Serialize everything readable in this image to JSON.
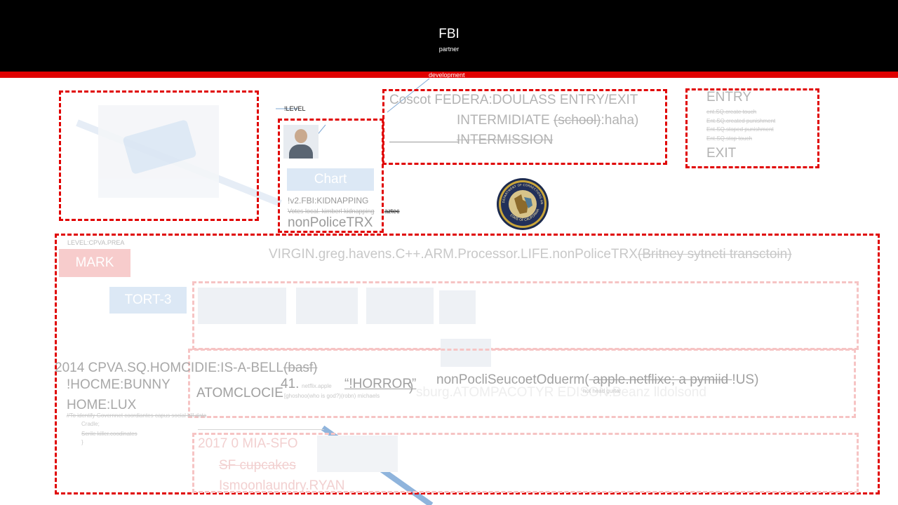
{
  "header": {
    "title": "FBI",
    "subtitle": "partner",
    "tab_label": "development"
  },
  "colors": {
    "header_bg": "#000000",
    "accent_red": "#e00000",
    "faint_red": "#f6c4c4",
    "chart_button": "#dce8f5",
    "mark_button": "#f7cccc",
    "tort_button": "#dce8f5"
  },
  "top_left": {
    "level_label": "!LEVEL",
    "chart_button": "Chart",
    "kidnapping_line": "!v2.FBI:KIDNAPPING",
    "votes_line": "Votes local. kimberl kidnapping",
    "aztec_label": "aztec",
    "nonpolice_label": "nonPoliceTRX"
  },
  "middle_box": {
    "line1": "Coscot FEDERA:DOULASS ENTRY/EXIT",
    "line2_main": "INTERMIDIATE ",
    "line2_strike": "(school)",
    "line2_tail": ":haha)",
    "line3": "INTERMISSION"
  },
  "right_box": {
    "entry": "ENTRY",
    "items": [
      "ent.SQ.create touch",
      "Ent.SQ.created punishment",
      "Ent.SQ.stoped punishment",
      "Ent.SQ.stop touch"
    ],
    "exit": "EXIT"
  },
  "seal": {
    "top_text": "DEPARTMENT OF CORRECTIONS AND REHABILITATION",
    "bottom_text": "STATE OF CALIFORNIA"
  },
  "bottom": {
    "level_label": "LEVEL:CPVA.PREA",
    "virgin_main": "VIRGIN.greg.havens.C++.ARM.Processor.LIFE.nonPoliceTRX",
    "virgin_strike": "(Britney sytneti transctoin)",
    "mark_button": "MARK",
    "tort_button": "TORT-3",
    "homicide_main": "2014 CPVA.SQ.HOMCIDIE:IS-A-BELL",
    "homicide_strike": "(basf)",
    "hocme": "!HOCME:BUNNY",
    "home": "HOME:LUX",
    "comment1": "//To identify Governnet coordiantes capus social kill data",
    "comment2": "Cradle;",
    "comment3": "Serile killer.coodinates",
    "comment4": "}",
    "atomclocie": "ATOMCLOCIE",
    "num41": "41.",
    "netflix_small": "netflix.apple",
    "horror": "“!HORROR”",
    "paren_close": ")",
    "ghoshoo": "[ghoshoo(who is god?)(robn) michaels",
    "nonpol_main": "nonPocliSeucoetOduerm(",
    "nonpol_strike": " apple.netflixe; a pymiid ",
    "nonpol_tail": "!US)",
    "hot_head": "hot head gurtar",
    "faded_line": "sburg.ATOMPACOTYR EDISON.Beanz lldolsond",
    "year2017": "2017 0 MIA-SFO",
    "sf_cupcakes": "SF cupcakes",
    "bottom_cut": "Ismoonlaundry.RYAN"
  }
}
